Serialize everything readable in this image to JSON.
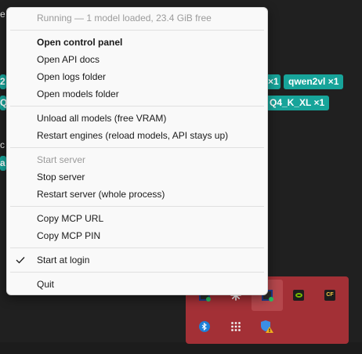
{
  "background": {
    "fragments": [
      "e",
      "2 s",
      "Q4",
      "c",
      "a"
    ],
    "chips": [
      "×1",
      "qwen2vl ×1",
      "Q4_K_XL ×1"
    ]
  },
  "menu": {
    "status": "Running — 1 model loaded, 23.4 GiB free",
    "items": {
      "open_control_panel": "Open control panel",
      "open_api_docs": "Open API docs",
      "open_logs_folder": "Open logs folder",
      "open_models_folder": "Open models folder",
      "unload_all_models": "Unload all models (free VRAM)",
      "restart_engines": "Restart engines (reload models, API stays up)",
      "start_server": "Start server",
      "stop_server": "Stop server",
      "restart_server": "Restart server (whole process)",
      "copy_mcp_url": "Copy MCP URL",
      "copy_mcp_pin": "Copy MCP PIN",
      "start_at_login": "Start at login",
      "quit": "Quit"
    },
    "start_at_login_checked": true
  },
  "tray": {
    "icons": [
      "app-tray-icon",
      "spark-icon",
      "app-tray-icon-active",
      "nvidia-icon",
      "cf-icon",
      "bluetooth-icon",
      "grid-dots-icon",
      "defender-warning-icon"
    ],
    "cf_label": "CF"
  },
  "colors": {
    "accent_chip": "#17a49a",
    "tray_bg": "#a33036",
    "status_dot": "#27c061"
  }
}
